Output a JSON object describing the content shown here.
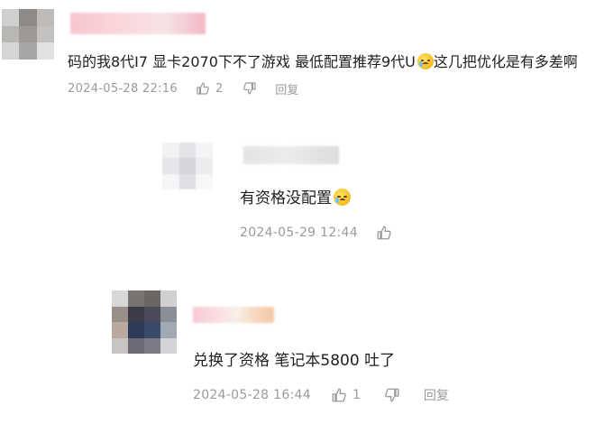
{
  "comments": [
    {
      "text": "码的我8代I7 显卡2070下不了游戏 最低配置推荐9代U",
      "tail": "这几把优化是有多差啊",
      "timestamp": "2024-05-28 22:16",
      "like_count": "2",
      "reply_label": "回复",
      "emoji": "cry-laugh-emoji"
    },
    {
      "text": "有资格没配置",
      "timestamp": "2024-05-29 12:44",
      "emoji": "cry-laugh-emoji"
    },
    {
      "text": "兑换了资格  笔记本5800  吐了",
      "timestamp": "2024-05-28 16:44",
      "like_count": "1",
      "reply_label": "回复"
    }
  ]
}
